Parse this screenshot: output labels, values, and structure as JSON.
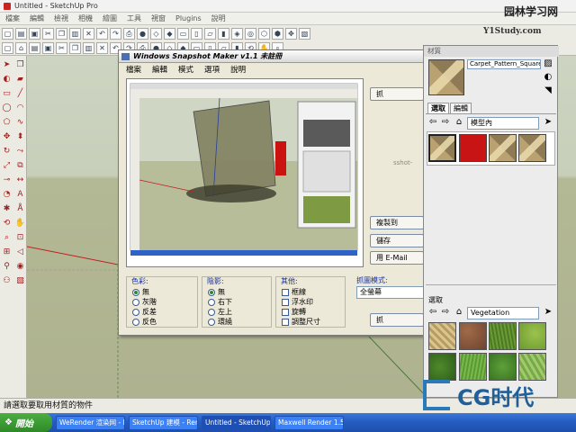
{
  "sketchup": {
    "title": "Untitled - SketchUp Pro",
    "menu": [
      "檔案",
      "編輯",
      "檢視",
      "相機",
      "繪圖",
      "工具",
      "視窗",
      "Plugins",
      "說明"
    ],
    "status_text": "請選取要取用材質的物件"
  },
  "dialog": {
    "title": "Windows Snapshot Maker v1.1 未註冊",
    "menu": [
      "檔案",
      "編輯",
      "模式",
      "選項",
      "說明"
    ],
    "buttons": {
      "top": "抓",
      "copy": "複製到",
      "save": "儲存",
      "email": "用 E-Mail",
      "bottom": "抓"
    },
    "side_text": "sshot-",
    "color": {
      "title": "色彩:",
      "options": [
        "無",
        "灰階",
        "反差",
        "反色"
      ],
      "selected": 0
    },
    "shadow": {
      "title": "陰影:",
      "options": [
        "無",
        "右下",
        "左上",
        "環繞"
      ],
      "selected": 0
    },
    "other": {
      "title": "其他:",
      "options": [
        "框線",
        "浮水印",
        "旋轉",
        "調整尺寸"
      ]
    },
    "capture_mode": {
      "title": "抓圖模式:",
      "value": "全螢幕"
    }
  },
  "materials": {
    "title": "材質",
    "name_value": "Carpet_Pattern_Squares",
    "tabs": [
      "選取",
      "編輯"
    ],
    "model_collection": "模型內",
    "model_swatches": [
      {
        "name": "carpet-pattern-sand-1",
        "color": "#a8946a"
      },
      {
        "name": "red",
        "color": "#c81414"
      },
      {
        "name": "carpet-pattern-sand-2",
        "color": "#a8946a"
      },
      {
        "name": "carpet-pattern-sand-3",
        "color": "#a8946a"
      }
    ],
    "select_label": "選取",
    "library_collection": "Vegetation",
    "veg_swatches": [
      {
        "name": "veg-dry-grass",
        "color": "#c9b27a"
      },
      {
        "name": "veg-brown-bush",
        "color": "#8a5a3e"
      },
      {
        "name": "veg-green-grass",
        "color": "#5b8a2c"
      },
      {
        "name": "veg-moss",
        "color": "#7ea83c"
      },
      {
        "name": "veg-dense-green",
        "color": "#3e7a22"
      },
      {
        "name": "veg-bright-grass",
        "color": "#6aa83a"
      },
      {
        "name": "veg-ivy",
        "color": "#4f8f2e"
      },
      {
        "name": "veg-pale-green",
        "color": "#8dbb5a"
      }
    ]
  },
  "taskbar": {
    "start_label": "開始",
    "items": [
      {
        "label": "WeRender 渲染网 - R...",
        "active": false
      },
      {
        "label": "SketchUp 建模 - Rend...",
        "active": false
      },
      {
        "label": "Untitled - SketchUp Pro",
        "active": true
      },
      {
        "label": "Maxwell Render 1.5",
        "active": false
      }
    ]
  },
  "watermarks": {
    "top_brand": "园林学习网",
    "url": "Y1Study.com",
    "bottom_brand": "CG时代"
  }
}
